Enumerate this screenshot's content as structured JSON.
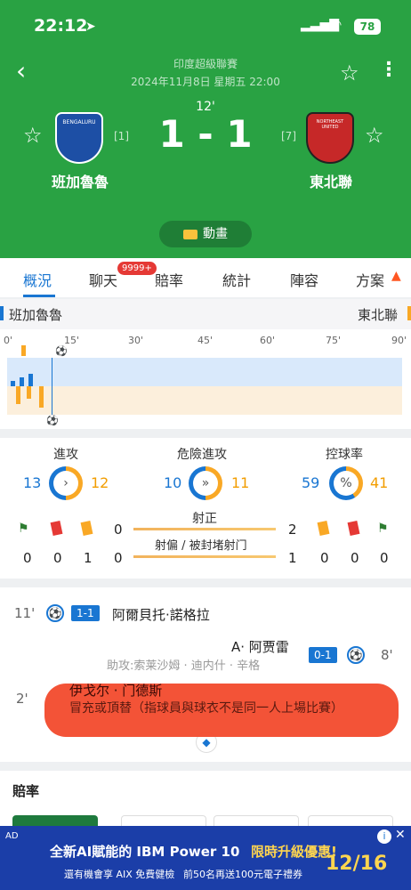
{
  "status_bar": {
    "time": "22:12",
    "battery": "78"
  },
  "header": {
    "league": "印度超級聯賽",
    "datetime": "2024年11月8日 星期五 22:00",
    "minute": "12'",
    "score": "1 - 1",
    "home": {
      "name": "班加魯魯",
      "rank": "[1]",
      "logo_text": "BENGALURU"
    },
    "away": {
      "name": "東北聯",
      "rank": "[7]",
      "logo_text": "NORTHEAST UNITED"
    },
    "animation_label": "動畫"
  },
  "tabs": [
    {
      "label": "概況"
    },
    {
      "label": "聊天"
    },
    {
      "label": "賠率"
    },
    {
      "label": "統計"
    },
    {
      "label": "陣容"
    },
    {
      "label": "方案"
    }
  ],
  "chat_badge": "9999+",
  "timeline": {
    "home": "班加魯魯",
    "away": "東北聯",
    "ticks": [
      "0'",
      "15'",
      "30'",
      "45'",
      "60'",
      "75'",
      "90'"
    ]
  },
  "stats": {
    "attack": {
      "label": "進攻",
      "home": "13",
      "away": "12"
    },
    "danger": {
      "label": "危險進攻",
      "home": "10",
      "away": "11"
    },
    "possession": {
      "label": "控球率",
      "home": "59",
      "away": "41"
    },
    "on_target": {
      "label": "射正",
      "home": "0",
      "away": "2"
    },
    "off_target": {
      "label": "射偏 / 被封堵射门",
      "home": "0",
      "away": "1"
    },
    "home_cards": [
      "0",
      "0",
      "1"
    ],
    "away_cards": [
      "0",
      "0",
      "0"
    ]
  },
  "events": [
    {
      "minute": "11'",
      "score": "1-1",
      "player": "阿爾貝托·諾格拉"
    },
    {
      "minute": "8'",
      "score": "0-1",
      "player": "A· 阿贾雷",
      "assist": "助攻:索莱沙姆 · 迪内什 · 辛格"
    },
    {
      "minute": "2'",
      "player": "伊戈尔 · 门德斯",
      "note": "冒充或頂替（指球員與球衣不是同一人上場比賽）"
    }
  ],
  "odds_title": "賠率",
  "ad": {
    "label": "AD",
    "text1": "全新AI賦能的 IBM Power 10",
    "text2": "限時升級優惠!",
    "text3": "還有機會享 AIX 免費健檢",
    "text4": "前50名再送100元電子禮券",
    "date": "12/16"
  }
}
